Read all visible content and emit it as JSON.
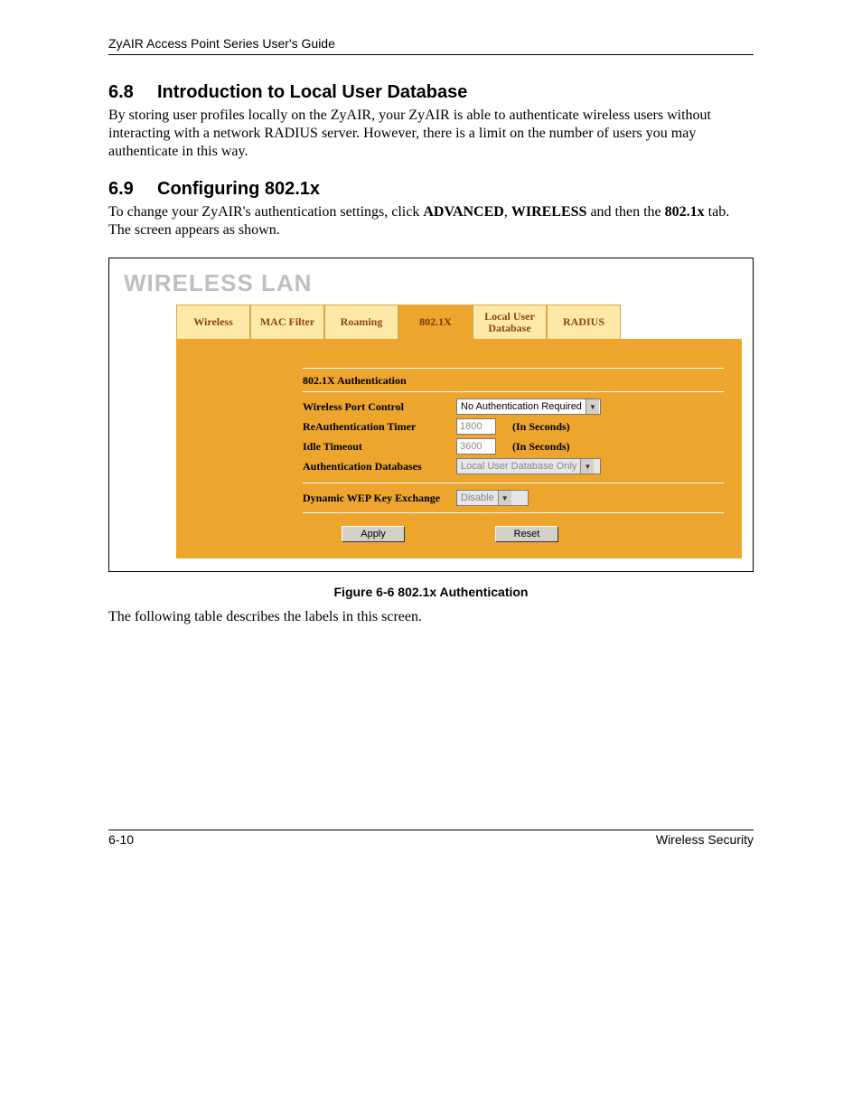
{
  "header": {
    "guide_title": "ZyAIR Access Point Series User's Guide"
  },
  "section_6_8": {
    "number": "6.8",
    "title": "Introduction to Local User Database",
    "body": "By storing user profiles locally on the ZyAIR, your ZyAIR is able to authenticate wireless users without interacting with a network RADIUS server. However, there is a limit on the number of users you may authenticate in this way."
  },
  "section_6_9": {
    "number": "6.9",
    "title": "Configuring 802.1x",
    "body_pre": "To change your ZyAIR's authentication settings, click ",
    "body_bold1": "ADVANCED",
    "body_mid1": ", ",
    "body_bold2": "WIRELESS",
    "body_mid2": " and then the ",
    "body_bold3": "802.1x",
    "body_post": " tab. The screen appears as shown."
  },
  "screenshot": {
    "page_title": "WIRELESS LAN",
    "tabs": {
      "t0": "Wireless",
      "t1": "MAC Filter",
      "t2": "Roaming",
      "t3": "802.1X",
      "t4": "Local User\nDatabase",
      "t5": "RADIUS"
    },
    "section_title": "802.1X Authentication",
    "rows": {
      "port_control": {
        "label": "Wireless Port Control",
        "value": "No Authentication Required"
      },
      "reauth_timer": {
        "label": "ReAuthentication Timer",
        "value": "1800",
        "suffix": "(In Seconds)"
      },
      "idle_timeout": {
        "label": "Idle Timeout",
        "value": "3600",
        "suffix": "(In Seconds)"
      },
      "auth_db": {
        "label": "Authentication Databases",
        "value": "Local User Database Only"
      },
      "dyn_wep": {
        "label": "Dynamic WEP Key Exchange",
        "value": "Disable"
      }
    },
    "buttons": {
      "apply": "Apply",
      "reset": "Reset"
    }
  },
  "figure_caption": "Figure 6-6 802.1x Authentication",
  "after_figure": "The following table describes the labels in this screen.",
  "footer": {
    "page_num": "6-10",
    "section_name": "Wireless Security"
  }
}
